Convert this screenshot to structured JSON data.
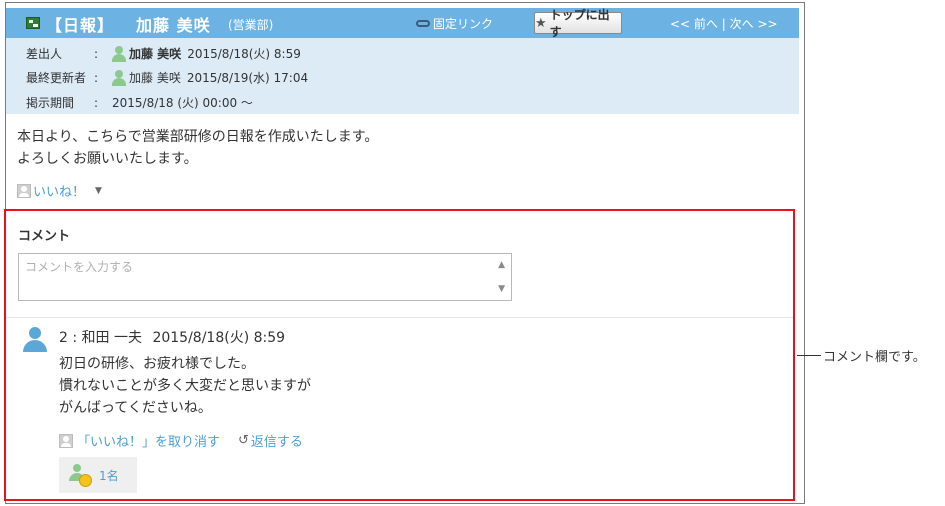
{
  "header": {
    "title": "【日報】",
    "author": "加藤 美咲",
    "dept": "(営業部)",
    "fixed_link": "固定リンク",
    "top_button": "トップに出す",
    "prev": "<< 前へ",
    "separator": "|",
    "next": "次へ >>"
  },
  "meta": {
    "sender_label": "差出人",
    "sender_name": "加藤 美咲",
    "sender_date": "2015/8/18(火) 8:59",
    "updater_label": "最終更新者",
    "updater_name": "加藤 美咲",
    "updater_date": "2015/8/19(水) 17:04",
    "period_label": "掲示期間",
    "period_value": "2015/8/18 (火) 00:00 ～",
    "colon": ":"
  },
  "body": {
    "line1": "本日より、こちらで営業部研修の日報を作成いたします。",
    "line2": "よろしくお願いいたします。",
    "like": "いいね！"
  },
  "comments": {
    "title": "コメント",
    "input_placeholder": "コメントを入力する",
    "entry": {
      "number": "2",
      "author": "和田 一夫",
      "date": "2015/8/18(火) 8:59",
      "line1": "初日の研修、お疲れ様でした。",
      "line2": "慣れないことが多く大変だと思いますが",
      "line3": "がんばってくださいね。",
      "unlike": "「いいね！」を取り消す",
      "reply": "返信する",
      "like_count": "1名"
    }
  },
  "callout": "コメント欄です。",
  "colors": {
    "header_bg": "#6cb3e3",
    "meta_bg": "#ddebf7",
    "link": "#4a9fd5",
    "highlight": "#e8121c"
  }
}
